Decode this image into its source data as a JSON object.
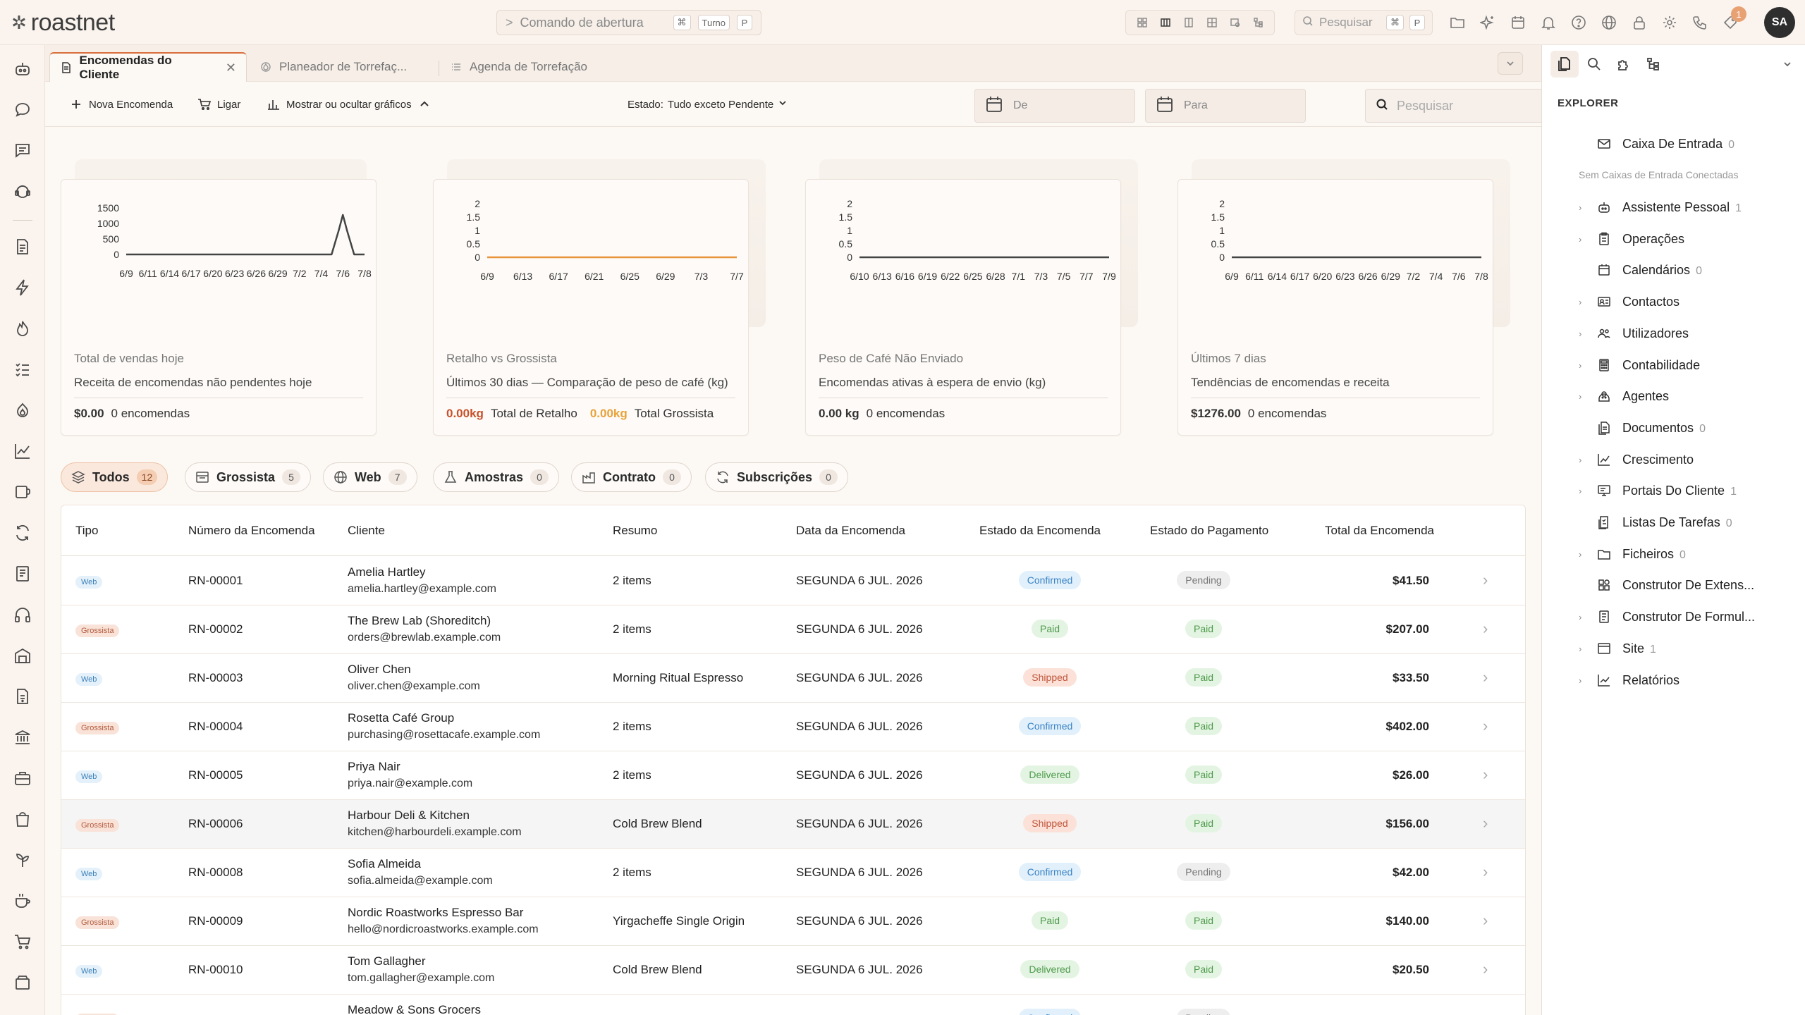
{
  "app": {
    "brand": "roastnet"
  },
  "topbar": {
    "command": {
      "label": "Comando de abertura",
      "key1": "⌘",
      "key2": "Turno",
      "key3": "P"
    },
    "search": {
      "label": "Pesquisar",
      "key1": "⌘",
      "key2": "P"
    },
    "notifications": "1",
    "avatar": "SA"
  },
  "tabs": [
    {
      "label": "Encomendas do Cliente",
      "icon": "document-icon",
      "active": true
    },
    {
      "label": "Planeador de Torrefaç...",
      "icon": "flame-icon"
    },
    {
      "label": "Agenda de Torrefação",
      "icon": "list-icon"
    }
  ],
  "toolbar": {
    "new_order": "Nova Encomenda",
    "call": "Ligar",
    "toggle_charts": "Mostrar ou ocultar gráficos",
    "status_label": "Estado:",
    "status_value": "Tudo exceto Pendente",
    "date_from": "De",
    "date_to": "Para",
    "search_placeholder": "Pesquisar"
  },
  "cards": [
    {
      "title": "Total de vendas hoje",
      "subtitle": "Receita de encomendas não pendentes hoje",
      "value": "$0.00",
      "value2": "0 encomendas"
    },
    {
      "title": "Retalho vs Grossista",
      "subtitle": "Últimos 30 dias — Comparação de peso de café (kg)",
      "value": "0.00kg",
      "value_label": "Total de Retalho",
      "value2": "0.00kg",
      "value2_label": "Total Grossista"
    },
    {
      "title": "Peso de Café Não Enviado",
      "subtitle": "Encomendas ativas à espera de envio (kg)",
      "value": "0.00 kg",
      "value2": "0 encomendas"
    },
    {
      "title": "Últimos 7 dias",
      "subtitle": "Tendências de encomendas e receita",
      "value": "$1276.00",
      "value2": "0 encomendas"
    }
  ],
  "chart_data": [
    {
      "type": "line",
      "x": [
        "6/9",
        "6/11",
        "6/14",
        "6/17",
        "6/20",
        "6/23",
        "6/26",
        "6/29",
        "7/2",
        "7/4",
        "7/6",
        "7/8"
      ],
      "series": [
        {
          "values": [
            0,
            0,
            0,
            0,
            0,
            0,
            0,
            0,
            0,
            0,
            1276,
            0
          ]
        }
      ],
      "y_ticks": [
        0,
        500,
        1000,
        1500
      ],
      "ylim": [
        0,
        1500
      ],
      "color": "#444444"
    },
    {
      "type": "line",
      "x": [
        "6/9",
        "6/13",
        "6/17",
        "6/21",
        "6/25",
        "6/29",
        "7/3",
        "7/7"
      ],
      "series": [
        {
          "values": [
            0,
            0,
            0,
            0,
            0,
            0,
            0,
            0
          ]
        }
      ],
      "y_ticks": [
        0,
        0.5,
        1,
        1.5,
        2
      ],
      "ylim": [
        0,
        2
      ],
      "color": "#e8943a"
    },
    {
      "type": "line",
      "x": [
        "6/10",
        "6/13",
        "6/16",
        "6/19",
        "6/22",
        "6/25",
        "6/28",
        "7/1",
        "7/3",
        "7/5",
        "7/7",
        "7/9"
      ],
      "series": [
        {
          "values": [
            0,
            0,
            0,
            0,
            0,
            0,
            0,
            0,
            0,
            0,
            0,
            0
          ]
        }
      ],
      "y_ticks": [
        0,
        0.5,
        1,
        1.5,
        2
      ],
      "ylim": [
        0,
        2
      ],
      "color": "#444444"
    },
    {
      "type": "line",
      "x": [
        "6/9",
        "6/11",
        "6/14",
        "6/17",
        "6/20",
        "6/23",
        "6/26",
        "6/29",
        "7/2",
        "7/4",
        "7/6",
        "7/8"
      ],
      "series": [
        {
          "values": [
            0,
            0,
            0,
            0,
            0,
            0,
            0,
            0,
            0,
            0,
            0,
            0
          ]
        }
      ],
      "y_ticks": [
        0,
        0.5,
        1,
        1.5,
        2
      ],
      "ylim": [
        0,
        2
      ],
      "color": "#444444"
    }
  ],
  "filters": [
    {
      "label": "Todos",
      "count": "12",
      "icon": "layers-icon",
      "active": true
    },
    {
      "label": "Grossista",
      "count": "5",
      "icon": "store-icon"
    },
    {
      "label": "Web",
      "count": "7",
      "icon": "globe-icon"
    },
    {
      "label": "Amostras",
      "count": "0",
      "icon": "flask-icon"
    },
    {
      "label": "Contrato",
      "count": "0",
      "icon": "factory-icon"
    },
    {
      "label": "Subscrições",
      "count": "0",
      "icon": "refresh-icon"
    }
  ],
  "table": {
    "headers": [
      "Tipo",
      "Número da Encomenda",
      "Cliente",
      "Resumo",
      "Data da Encomenda",
      "Estado da Encomenda",
      "Estado do Pagamento",
      "Total da Encomenda"
    ],
    "rows": [
      {
        "type": "Web",
        "number": "RN-00001",
        "name": "Amelia Hartley",
        "email": "amelia.hartley@example.com",
        "summary": "2 items",
        "date": "SEGUNDA 6 JUL. 2026",
        "order_status": "Confirmed",
        "payment_status": "Pending",
        "total": "$41.50"
      },
      {
        "type": "Grossista",
        "number": "RN-00002",
        "name": "The Brew Lab (Shoreditch)",
        "email": "orders@brewlab.example.com",
        "summary": "2 items",
        "date": "SEGUNDA 6 JUL. 2026",
        "order_status": "Paid",
        "payment_status": "Paid",
        "total": "$207.00"
      },
      {
        "type": "Web",
        "number": "RN-00003",
        "name": "Oliver Chen",
        "email": "oliver.chen@example.com",
        "summary": "Morning Ritual Espresso",
        "date": "SEGUNDA 6 JUL. 2026",
        "order_status": "Shipped",
        "payment_status": "Paid",
        "total": "$33.50"
      },
      {
        "type": "Grossista",
        "number": "RN-00004",
        "name": "Rosetta Café Group",
        "email": "purchasing@rosettacafe.example.com",
        "summary": "2 items",
        "date": "SEGUNDA 6 JUL. 2026",
        "order_status": "Confirmed",
        "payment_status": "Paid",
        "total": "$402.00"
      },
      {
        "type": "Web",
        "number": "RN-00005",
        "name": "Priya Nair",
        "email": "priya.nair@example.com",
        "summary": "2 items",
        "date": "SEGUNDA 6 JUL. 2026",
        "order_status": "Delivered",
        "payment_status": "Paid",
        "total": "$26.00"
      },
      {
        "type": "Grossista",
        "number": "RN-00006",
        "name": "Harbour Deli & Kitchen",
        "email": "kitchen@harbourdeli.example.com",
        "summary": "Cold Brew Blend",
        "date": "SEGUNDA 6 JUL. 2026",
        "order_status": "Shipped",
        "payment_status": "Paid",
        "total": "$156.00",
        "highlight": true
      },
      {
        "type": "Web",
        "number": "RN-00008",
        "name": "Sofia Almeida",
        "email": "sofia.almeida@example.com",
        "summary": "2 items",
        "date": "SEGUNDA 6 JUL. 2026",
        "order_status": "Confirmed",
        "payment_status": "Pending",
        "total": "$42.00"
      },
      {
        "type": "Grossista",
        "number": "RN-00009",
        "name": "Nordic Roastworks Espresso Bar",
        "email": "hello@nordicroastworks.example.com",
        "summary": "Yirgacheffe Single Origin",
        "date": "SEGUNDA 6 JUL. 2026",
        "order_status": "Paid",
        "payment_status": "Paid",
        "total": "$140.00"
      },
      {
        "type": "Web",
        "number": "RN-00010",
        "name": "Tom Gallagher",
        "email": "tom.gallagher@example.com",
        "summary": "Cold Brew Blend",
        "date": "SEGUNDA 6 JUL. 2026",
        "order_status": "Delivered",
        "payment_status": "Paid",
        "total": "$20.50"
      },
      {
        "type": "Grossista",
        "number": "",
        "name": "Meadow & Sons Grocers",
        "email": "",
        "summary": "",
        "date": "",
        "order_status": "Confirmed",
        "payment_status": "Pending",
        "total": ""
      }
    ]
  },
  "explorer": {
    "heading": "EXPLORER",
    "inbox": {
      "label": "Caixa De Entrada",
      "count": "0"
    },
    "note": "Sem Caixas de Entrada Conectadas",
    "items": [
      {
        "label": "Assistente Pessoal",
        "count": "1",
        "arrow": true,
        "icon": "robot-icon"
      },
      {
        "label": "Operações",
        "count": "",
        "arrow": true,
        "icon": "clipboard-icon"
      },
      {
        "label": "Calendários",
        "count": "0",
        "arrow": false,
        "icon": "calendar-icon"
      },
      {
        "label": "Contactos",
        "count": "",
        "arrow": true,
        "icon": "contact-card-icon"
      },
      {
        "label": "Utilizadores",
        "count": "",
        "arrow": true,
        "icon": "users-icon"
      },
      {
        "label": "Contabilidade",
        "count": "",
        "arrow": true,
        "icon": "calculator-icon"
      },
      {
        "label": "Agentes",
        "count": "",
        "arrow": true,
        "icon": "agent-icon"
      },
      {
        "label": "Documentos",
        "count": "0",
        "arrow": false,
        "icon": "documents-icon"
      },
      {
        "label": "Crescimento",
        "count": "",
        "arrow": true,
        "icon": "chart-line-icon"
      },
      {
        "label": "Portais Do Cliente",
        "count": "1",
        "arrow": true,
        "icon": "portal-icon"
      },
      {
        "label": "Listas De Tarefas",
        "count": "0",
        "arrow": false,
        "icon": "checklist-icon"
      },
      {
        "label": "Ficheiros",
        "count": "0",
        "arrow": true,
        "icon": "folder-icon"
      },
      {
        "label": "Construtor De Extens...",
        "count": "",
        "arrow": false,
        "icon": "extension-icon"
      },
      {
        "label": "Construtor De Formul...",
        "count": "",
        "arrow": true,
        "icon": "form-icon"
      },
      {
        "label": "Site",
        "count": "1",
        "arrow": true,
        "icon": "browser-icon"
      },
      {
        "label": "Relatórios",
        "count": "",
        "arrow": true,
        "icon": "report-icon"
      }
    ]
  }
}
